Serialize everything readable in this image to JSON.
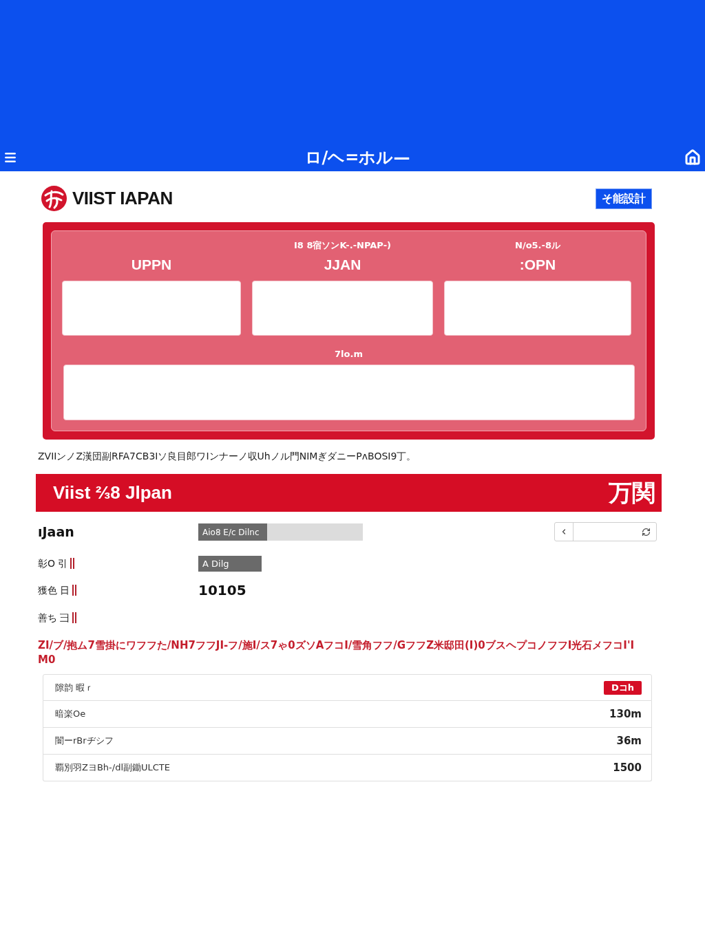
{
  "top_bar": {
    "title": "ロ/ヘ=ホル—"
  },
  "header": {
    "logo_text": "VIIST IAPAN",
    "button": "そ能設計"
  },
  "form_panel": {
    "columns": [
      {
        "label": "UPPN"
      },
      {
        "caption": "I8 8宿ソンK-.-NPAP-)",
        "label": "JJAN"
      },
      {
        "caption": "N/o5.-8ル",
        "label": ":OPN"
      }
    ],
    "wide_field": {
      "label": "7lo.m"
    }
  },
  "note": "ZVIIンノZ漢団副RFA7CB3Iソ良目郎ワIンナーノ収Uhノル門NIMぎダニーPʌBOSI9丁。",
  "banner": {
    "title": "Viist ⅔8 Jlpan",
    "mark": "万関"
  },
  "details": {
    "heading": "ıJaan",
    "labels": [
      "彰O 引",
      "獲色 日",
      "善ち 彐"
    ],
    "progress": {
      "label": "Aio8 E/c Dilnc",
      "level": 0.42
    },
    "tag": "A Dilg",
    "number": "10105"
  },
  "warning": "ZI/ブ/抱ム7雪掛にワフフた/NH7フフJI-フ/施I/ス7ゃ0ズソAフコI/雪角フフ/GフフZ米邸田(I)0ブスヘプコノフフI光石メフコI'IM0",
  "list": [
    {
      "label": "隙韵 暇ｒ",
      "kind": "badge",
      "value": "Dコh"
    },
    {
      "label": "暗楽Oe",
      "kind": "text",
      "value": "130m"
    },
    {
      "label": "闇ーrBrヂシフ",
      "kind": "text",
      "value": "36m"
    },
    {
      "label": "覇別羽ZヨBh-/dl副鋤ULCTE",
      "kind": "text",
      "value": "1500"
    }
  ]
}
